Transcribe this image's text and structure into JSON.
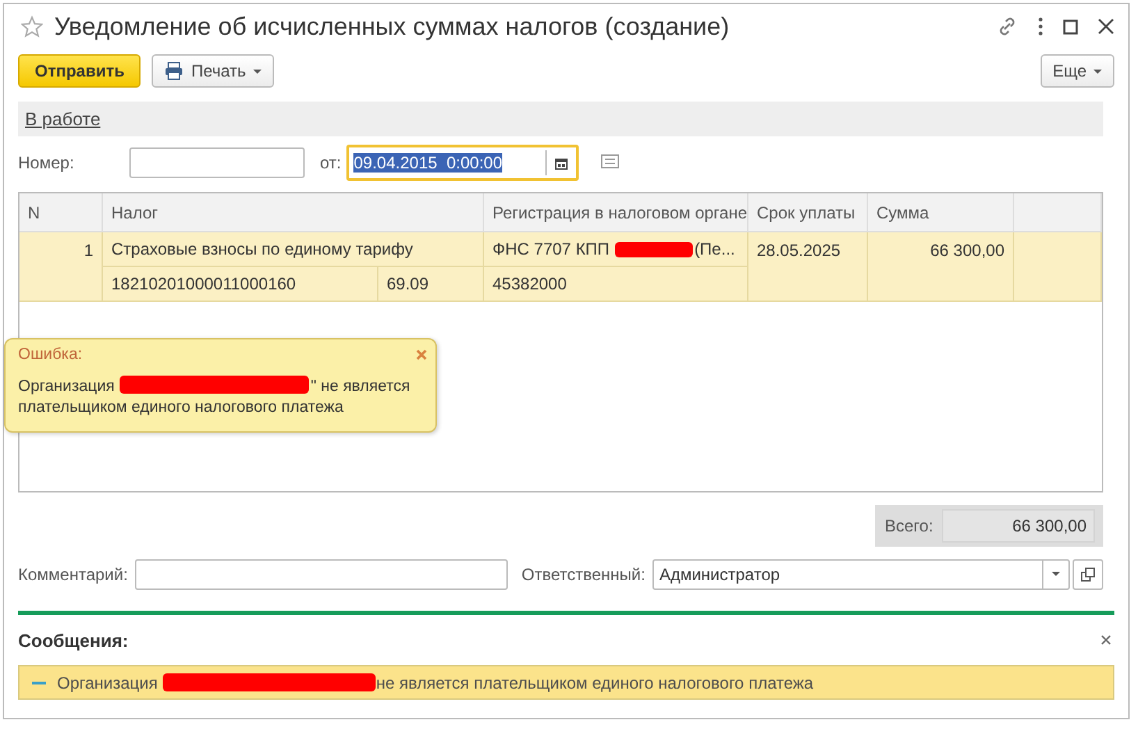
{
  "window": {
    "title": "Уведомление об исчисленных суммах налогов (создание)"
  },
  "toolbar": {
    "buttons": [
      {
        "label": "Отправить",
        "kind": "primary"
      },
      {
        "label": "Печать",
        "kind": "print"
      }
    ],
    "more": "Еще"
  },
  "status": {
    "label": "В работе"
  },
  "header_fields": {
    "number_label": "Номер:",
    "date_label": "от:",
    "date_value": "09.04.2015  0:00:00"
  },
  "table": {
    "columns": [
      "N",
      "Налог",
      "Регистрация в налоговом органе",
      "Срок уплаты",
      "Сумма"
    ],
    "rows": [
      {
        "n": "1",
        "tax": "Страховые взносы по единому тарифу",
        "kbk": "18210201000011000160",
        "account": "69.09",
        "registration": [
          "ФНС 7707 КПП",
          "(Пе..."
        ],
        "oktmo": "45382000",
        "due": "28.05.2025",
        "sum": "66 300,00",
        "selected": true
      }
    ]
  },
  "error_popup": {
    "title": "Ошибка:",
    "text": [
      "Организация",
      "\" не является плательщиком единого налогового платежа"
    ]
  },
  "totals": {
    "label": "Всего:",
    "value": "66 300,00"
  },
  "footer_fields": {
    "comment_label": "Комментарий:",
    "responsible_label": "Ответственный:",
    "responsible_value": "Администратор"
  },
  "messages": {
    "title": "Сообщения:",
    "items": [
      {
        "text": [
          "Организация",
          "не является плательщиком единого налогового платежа"
        ]
      }
    ]
  }
}
